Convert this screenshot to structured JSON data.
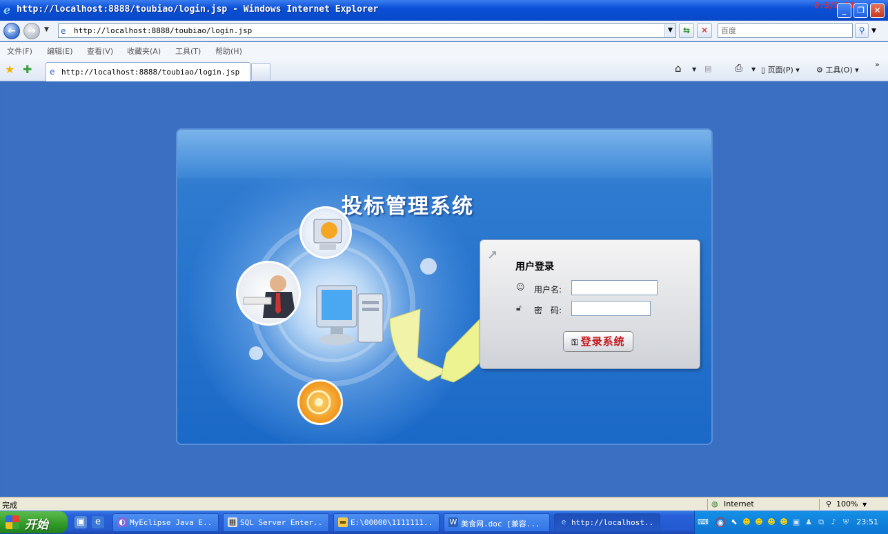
{
  "window": {
    "title": "http://localhost:8888/toubiao/login.jsp - Windows Internet Explorer",
    "clock_overlay": "0:3/2:54"
  },
  "address": {
    "url": "http://localhost:8888/toubiao/login.jsp",
    "search_placeholder": "百度"
  },
  "menu": {
    "items": [
      "文件(F)",
      "编辑(E)",
      "查看(V)",
      "收藏夹(A)",
      "工具(T)",
      "帮助(H)"
    ]
  },
  "tabs": {
    "active_label": "http://localhost:8888/toubiao/login.jsp"
  },
  "commandbar": {
    "page_label": "页面(P)",
    "tools_label": "工具(O)"
  },
  "page": {
    "system_title": "投标管理系统",
    "login": {
      "heading": "用户登录",
      "username_label": "用户名:",
      "password_label": "密　码:",
      "username_value": "",
      "password_value": "",
      "button_label": "登录系统"
    }
  },
  "status": {
    "left": "完成",
    "zone": "Internet",
    "zoom": "100%"
  },
  "taskbar": {
    "start_label": "开始",
    "tasks": [
      "MyEclipse Java E...",
      "SQL Server Enter...",
      "E:\\00000\\1111111...",
      "美食网.doc [兼容...",
      "http://localhost..."
    ],
    "time": "23:51"
  },
  "colors": {
    "titlebar": "#0a4fd6",
    "page_background": "#3b6fc1",
    "login_button_text": "#c4161c",
    "clock_overlay": "#ff2020"
  }
}
